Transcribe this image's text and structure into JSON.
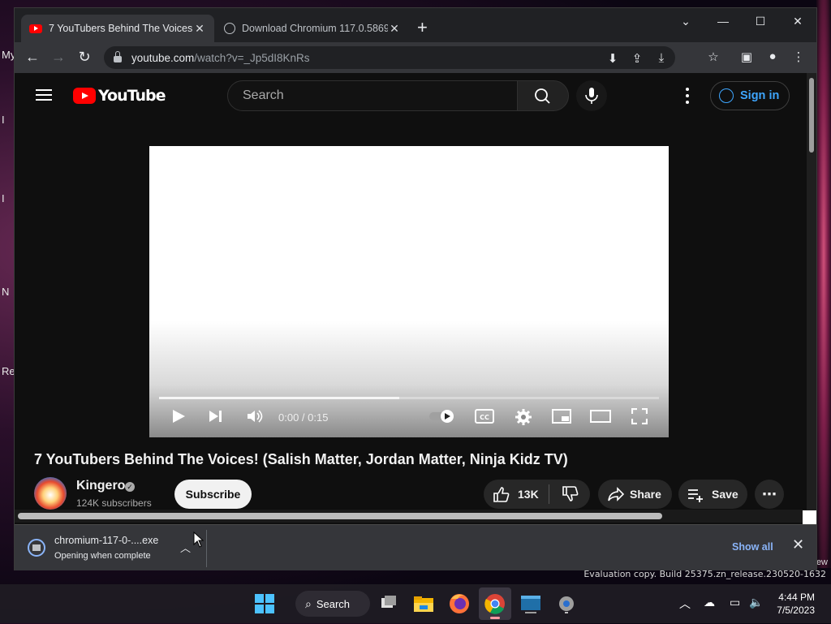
{
  "desktop": {
    "left_labels": [
      "My",
      "I",
      "I",
      "N",
      "Re"
    ],
    "watermark_top": "ew",
    "watermark": "Evaluation copy. Build 25375.zn_release.230520-1632"
  },
  "browser": {
    "tabs": [
      {
        "title": "7 YouTubers Behind The Voices! (",
        "close": "✕"
      },
      {
        "title": "Download Chromium 117.0.5869",
        "close": "✕"
      }
    ],
    "new_tab": "+",
    "window_controls": {
      "dropdown": "⌄",
      "minimize": "—",
      "maximize": "☐",
      "close": "✕"
    },
    "address": {
      "host": "youtube.com",
      "path": "/watch?v=_Jp5dI8KnRs"
    }
  },
  "youtube": {
    "logo_text": "YouTube",
    "search_placeholder": "Search",
    "sign_in": "Sign in",
    "player": {
      "time": "0:00 / 0:15",
      "progress": 0.0,
      "buffered": 0.48
    },
    "video_title": "7 YouTubers Behind The Voices! (Salish Matter, Jordan Matter, Ninja Kidz TV)",
    "channel": {
      "name": "Kingero",
      "subscribers": "124K subscribers"
    },
    "subscribe": "Subscribe",
    "actions": {
      "likes": "13K",
      "share": "Share",
      "save": "Save"
    }
  },
  "download_bar": {
    "file": "chromium-117-0-....exe",
    "status": "Opening when complete",
    "show_all": "Show all"
  },
  "taskbar": {
    "search": "Search",
    "time": "4:44 PM",
    "date": "7/5/2023"
  },
  "colors": {
    "yt_red": "#ff0000",
    "link_blue": "#3ea6ff",
    "chrome_blue": "#8ab4f8",
    "page_bg": "#0f0f0f"
  }
}
